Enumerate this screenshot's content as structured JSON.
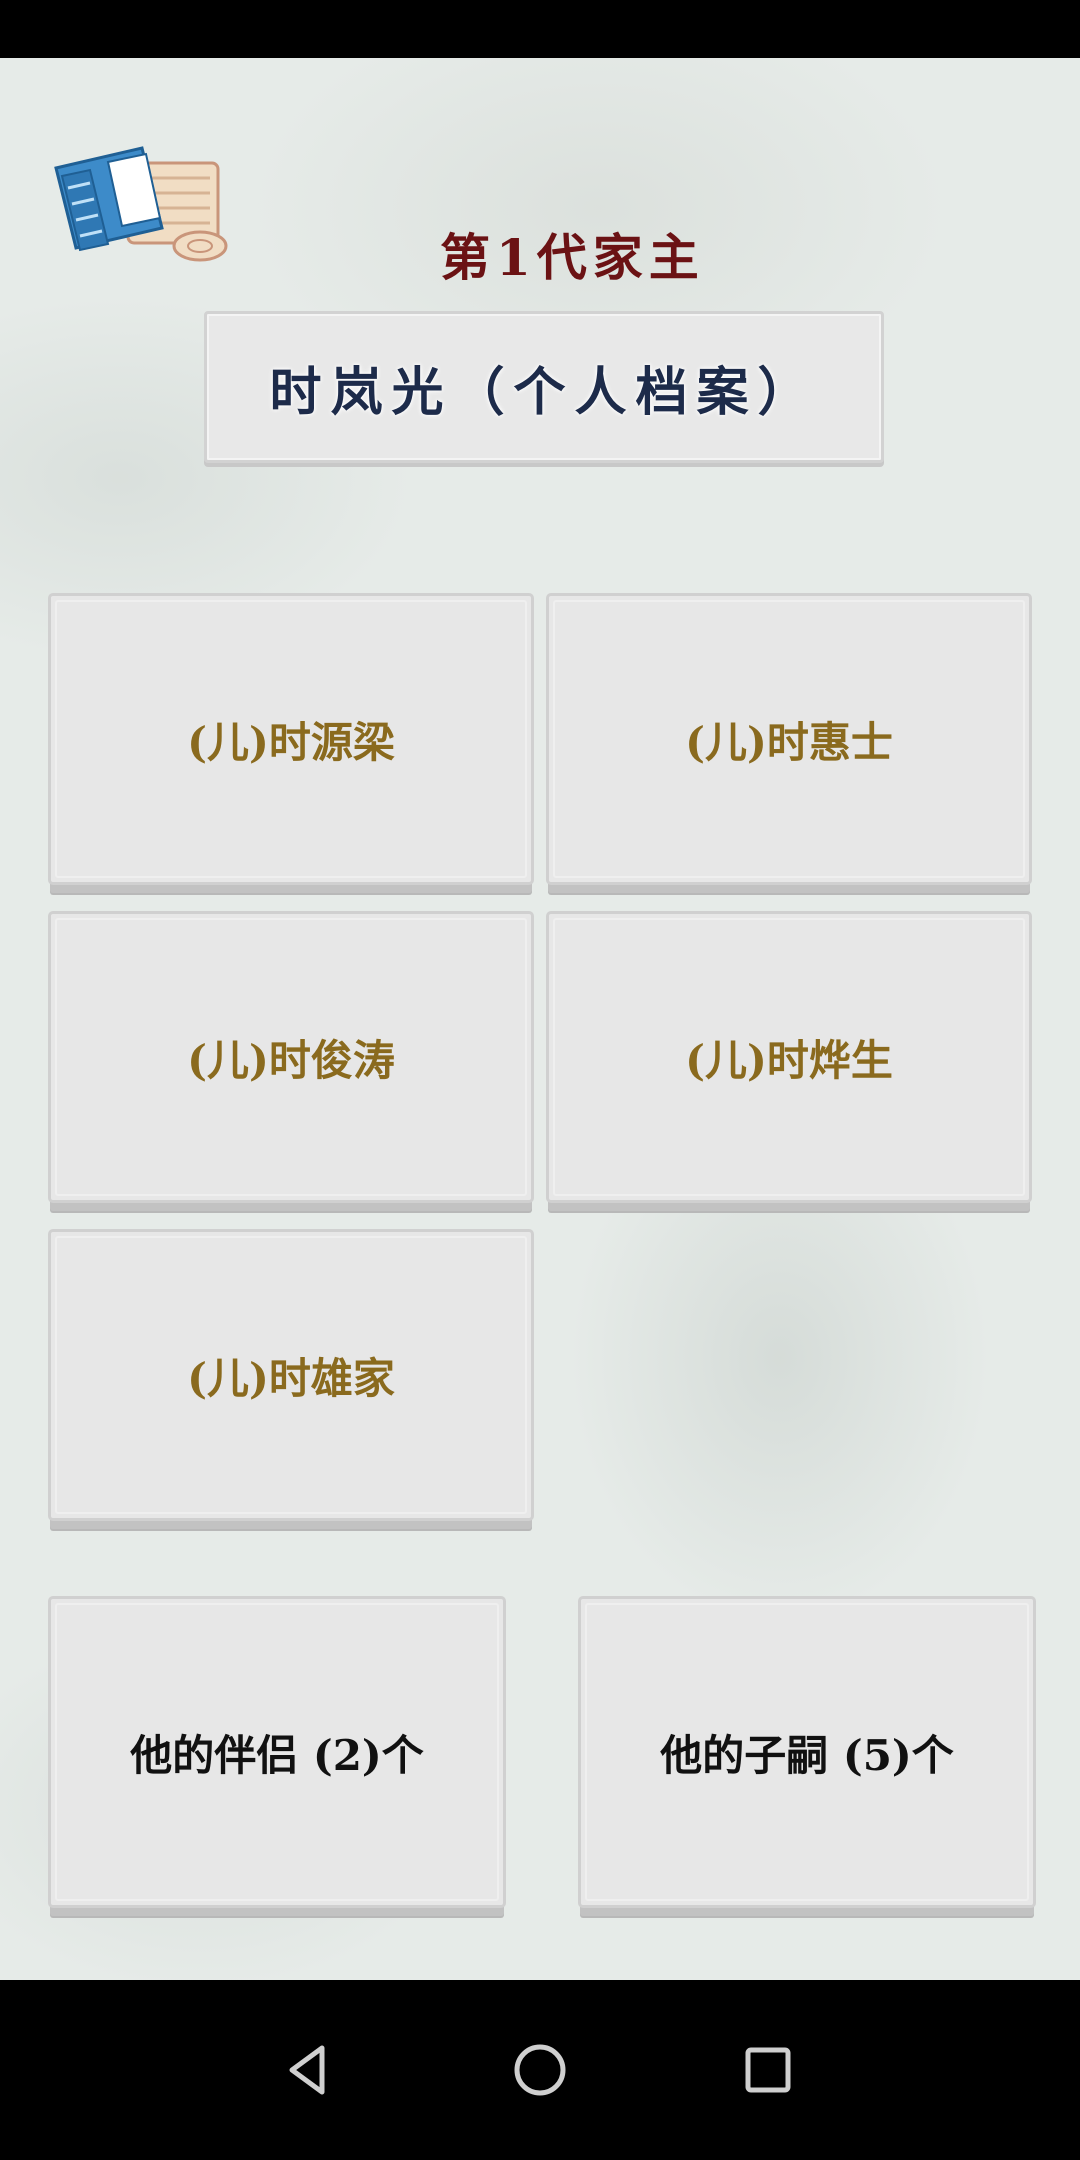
{
  "header": {
    "generation_title": "第1代家主",
    "person_name": "时岚光（个人档案）"
  },
  "children": [
    {
      "label": "(儿)时源梁"
    },
    {
      "label": "(儿)时惠士"
    },
    {
      "label": "(儿)时俊涛"
    },
    {
      "label": "(儿)时烨生"
    },
    {
      "label": "(儿)时雄家"
    }
  ],
  "footer": {
    "partners_label": "他的伴侣 (2)个",
    "heirs_label": "他的子嗣 (5)个"
  },
  "icons": {
    "book": "book-scroll-icon",
    "back": "back-triangle-icon",
    "home": "home-circle-icon",
    "recents": "recents-square-icon"
  },
  "colors": {
    "generation_title": "#6b1214",
    "person_name": "#1d2b4a",
    "child_label": "#8a6a1e",
    "button_label": "#111111",
    "background": "#e6ebe8"
  }
}
